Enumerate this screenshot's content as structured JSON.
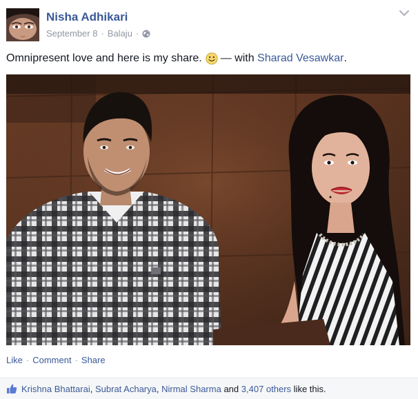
{
  "post": {
    "author": "Nisha Adhikari",
    "date": "September 8",
    "location": "Balaju",
    "separator": "·",
    "caption_text": "Omnipresent love and here is my share.",
    "with_text": "— with",
    "tagged_person": "Sharad Vesawkar",
    "caption_end": "."
  },
  "icons": {
    "privacy": "globe-icon",
    "options": "chevron-down-icon",
    "emoji": "smile-emoji-icon",
    "like": "thumbs-up-icon"
  },
  "actions": {
    "like": "Like",
    "comment": "Comment",
    "share": "Share",
    "sep1": "·",
    "sep2": "·"
  },
  "likes": {
    "name1": "Krishna Bhattarai",
    "comma1": ",",
    "name2": "Subrat Acharya",
    "comma2": ",",
    "name3": "Nirmal Sharma",
    "and_text": "and",
    "others": "3,407 others",
    "suffix": "like this."
  },
  "colors": {
    "link": "#3b5998",
    "meta": "#9197a3",
    "text": "#141823",
    "likes_bg": "#f6f7f8"
  }
}
